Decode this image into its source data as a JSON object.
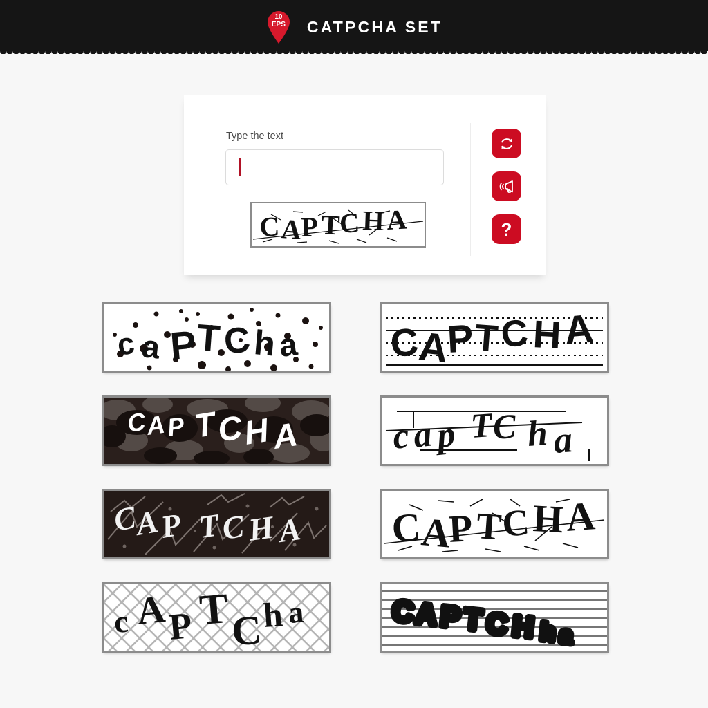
{
  "header": {
    "title": "CATPCHA SET",
    "badge": {
      "line1": "10",
      "line2": "EPS",
      "icon": "map-pin-badge"
    },
    "background_color": "#151515"
  },
  "colors": {
    "page_background": "#f7f7f7",
    "accent_red": "#cc0c22",
    "badge_red": "#d6192c",
    "caret_red": "#b11226",
    "frame_gray": "#8c8c8c",
    "header_black": "#151515",
    "label_gray": "#4a4a4a"
  },
  "form_card": {
    "label": "Type the text",
    "input": {
      "value": "",
      "placeholder": ""
    },
    "captcha_image": {
      "text": "CAPTCHA",
      "style": "serif scratched with diagonal strike-through on white"
    },
    "buttons": [
      {
        "name": "refresh-button",
        "icon": "refresh-icon",
        "label": "Refresh"
      },
      {
        "name": "audio-button",
        "icon": "megaphone-icon",
        "label": "Audio"
      },
      {
        "name": "help-button",
        "icon": "question-mark-icon",
        "label": "?"
      }
    ]
  },
  "samples": [
    {
      "id": "sample-1",
      "text": "caPTCha",
      "style": "dots",
      "background": "#ffffff",
      "text_color": "#111111",
      "description": "black speckled dots on white"
    },
    {
      "id": "sample-2",
      "text": "CAPTCHA",
      "style": "dashed-lines",
      "background": "#ffffff",
      "text_color": "#111111",
      "description": "horizontal dashed and solid lines on white"
    },
    {
      "id": "sample-3",
      "text": "CAPTCHA",
      "style": "camouflage",
      "background": "#2a1f1c",
      "text_color": "#ffffff",
      "description": "dark camouflage blobs with white brush text"
    },
    {
      "id": "sample-4",
      "text": "capTCha",
      "style": "ruled-lines",
      "background": "#ffffff",
      "text_color": "#111111",
      "description": "black brush script over horizontal rules"
    },
    {
      "id": "sample-5",
      "text": "CAPTCHA",
      "style": "zigzag-dark",
      "background": "#241a17",
      "text_color": "#f2f2f2",
      "description": "dark background with gray zigzag arrows and white text"
    },
    {
      "id": "sample-6",
      "text": "CAPTCHA",
      "style": "scratched",
      "background": "#ffffff",
      "text_color": "#111111",
      "description": "serif text with scratch marks and diagonal strike"
    },
    {
      "id": "sample-7",
      "text": "cAPTCha",
      "style": "crosshatch",
      "background": "#ffffff",
      "text_color": "#111111",
      "description": "diagonal crosshatch grid with handwritten text"
    },
    {
      "id": "sample-8",
      "text": "CAPTCha",
      "style": "spiky-lines",
      "background": "#ffffff",
      "text_color": "#111111",
      "description": "spiky burst letters over horizontal rules"
    }
  ]
}
